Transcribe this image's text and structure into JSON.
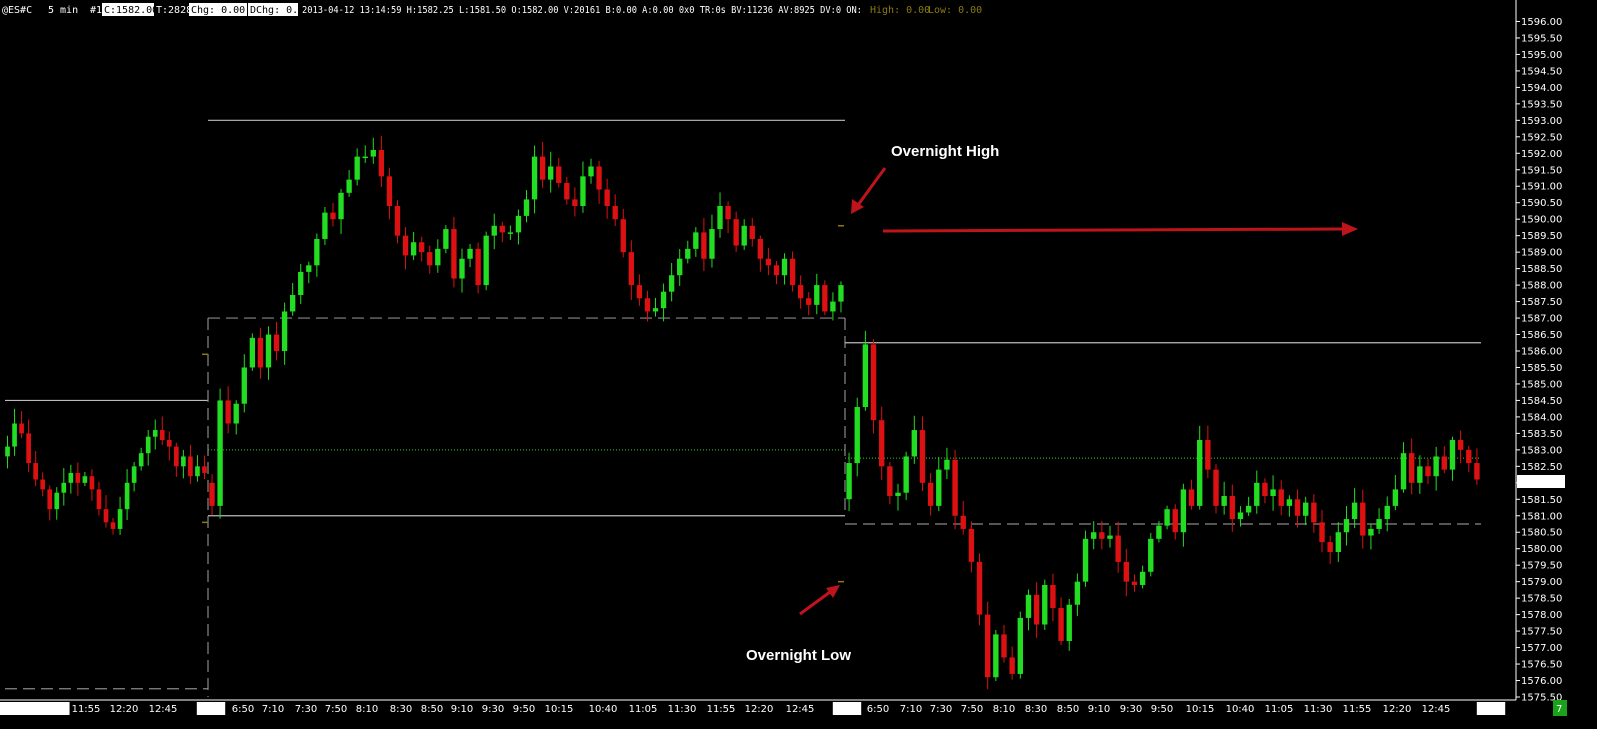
{
  "header": {
    "symbol": "@ES#C",
    "interval": "5 min",
    "id": "#1",
    "close": "C:1582.00",
    "ticks": "T:2828",
    "chg": "Chg: 0.00",
    "dchg": "DChg: 0.00",
    "info": "2013-04-12 13:14:59 H:1582.25 L:1581.50 O:1582.00 V:20161 B:0.00 A:0.00 0x0 TR:0s BV:11236 AV:8925 DV:0 ON:",
    "high": "High: 0.00",
    "low": "Low: 0.00"
  },
  "price_tag": "1582.00",
  "corner_badge": "7",
  "annotations": {
    "overnight_high": "Overnight High",
    "overnight_low": "Overnight Low"
  },
  "colors": {
    "background": "#000000",
    "up": "#22dd22",
    "down": "#dd1111",
    "level_line": "#bbbbbb",
    "dash_line": "#888888",
    "midline": "#33cc33",
    "arrow": "#c0141c"
  },
  "chart_data": {
    "type": "candlestick",
    "ylim": [
      1575.5,
      1596.5
    ],
    "yticks": [
      "1596.00",
      "1595.50",
      "1595.00",
      "1594.50",
      "1594.00",
      "1593.50",
      "1593.00",
      "1592.50",
      "1592.00",
      "1591.50",
      "1591.00",
      "1590.50",
      "1590.00",
      "1589.50",
      "1589.00",
      "1588.50",
      "1588.00",
      "1587.50",
      "1587.00",
      "1586.50",
      "1586.00",
      "1585.50",
      "1585.00",
      "1584.50",
      "1584.00",
      "1583.50",
      "1583.00",
      "1582.50",
      "1582.00",
      "1581.50",
      "1581.00",
      "1580.50",
      "1580.00",
      "1579.50",
      "1579.00",
      "1578.50",
      "1578.00",
      "1577.50",
      "1577.00",
      "1576.50",
      "1576.00",
      "1575.50"
    ],
    "xticks": [
      {
        "label": "10 11:05:00",
        "boxed": true
      },
      {
        "label": "11:55"
      },
      {
        "label": "12:20"
      },
      {
        "label": "12:45"
      },
      {
        "label": "4-11",
        "boxed": true
      },
      {
        "label": "6:50"
      },
      {
        "label": "7:10"
      },
      {
        "label": "7:30"
      },
      {
        "label": "7:50"
      },
      {
        "label": "8:10"
      },
      {
        "label": "8:30"
      },
      {
        "label": "8:50"
      },
      {
        "label": "9:10"
      },
      {
        "label": "9:30"
      },
      {
        "label": "9:50"
      },
      {
        "label": "10:15"
      },
      {
        "label": "10:40"
      },
      {
        "label": "11:05"
      },
      {
        "label": "11:30"
      },
      {
        "label": "11:55"
      },
      {
        "label": "12:20"
      },
      {
        "label": "12:45"
      },
      {
        "label": "4-12",
        "boxed": true
      },
      {
        "label": "6:50"
      },
      {
        "label": "7:10"
      },
      {
        "label": "7:30"
      },
      {
        "label": "7:50"
      },
      {
        "label": "8:10"
      },
      {
        "label": "8:30"
      },
      {
        "label": "8:50"
      },
      {
        "label": "9:10"
      },
      {
        "label": "9:30"
      },
      {
        "label": "9:50"
      },
      {
        "label": "10:15"
      },
      {
        "label": "10:40"
      },
      {
        "label": "11:05"
      },
      {
        "label": "11:30"
      },
      {
        "label": "11:55"
      },
      {
        "label": "12:20"
      },
      {
        "label": "12:45"
      },
      {
        "label": "4-13",
        "boxed": true
      }
    ],
    "session1_close": [
      1583.1,
      1583.8,
      1583.5,
      1582.6,
      1582.1,
      1581.8,
      1581.2,
      1581.7,
      1582.0,
      1582.3,
      1582.0,
      1582.2,
      1581.8,
      1581.2,
      1580.8,
      1580.6,
      1581.2,
      1582.0,
      1582.5,
      1582.9,
      1583.4,
      1583.6,
      1583.3,
      1583.1,
      1582.5,
      1582.8,
      1582.2,
      1582.5,
      1582.3
    ],
    "session2_close": [
      1581.3,
      1584.5,
      1583.8,
      1584.4,
      1585.5,
      1586.4,
      1585.5,
      1586.5,
      1586.0,
      1587.2,
      1587.7,
      1588.4,
      1588.6,
      1589.4,
      1590.2,
      1590.0,
      1590.8,
      1591.2,
      1591.9,
      1591.9,
      1592.1,
      1591.3,
      1590.4,
      1589.5,
      1588.9,
      1589.3,
      1589.0,
      1588.6,
      1589.1,
      1589.7,
      1588.2,
      1588.8,
      1589.1,
      1588.0,
      1589.5,
      1589.8,
      1589.6,
      1589.6,
      1590.1,
      1590.6,
      1591.9,
      1591.2,
      1591.6,
      1591.1,
      1590.6,
      1590.4,
      1591.3,
      1591.6,
      1590.9,
      1590.4,
      1590.0,
      1589.0,
      1588.0,
      1587.6,
      1587.2,
      1587.3,
      1587.8,
      1588.3,
      1588.8,
      1589.1,
      1589.6,
      1588.8,
      1589.7,
      1590.4,
      1590.0,
      1589.2,
      1589.8,
      1589.4,
      1588.8,
      1588.6,
      1588.3,
      1588.8,
      1588.0,
      1587.6,
      1587.4,
      1588.0,
      1587.2,
      1587.5,
      1588.0
    ],
    "session3_close": [
      1582.6,
      1584.3,
      1586.2,
      1583.9,
      1582.5,
      1581.6,
      1581.7,
      1582.8,
      1583.6,
      1582.0,
      1581.3,
      1582.4,
      1582.7,
      1581.0,
      1580.6,
      1579.6,
      1578.0,
      1576.1,
      1577.4,
      1576.7,
      1576.2,
      1577.9,
      1578.6,
      1577.7,
      1578.9,
      1578.2,
      1577.2,
      1578.3,
      1579.0,
      1580.3,
      1580.5,
      1580.3,
      1580.4,
      1579.6,
      1579.0,
      1578.9,
      1579.3,
      1580.3,
      1580.7,
      1581.2,
      1580.5,
      1581.8,
      1581.3,
      1583.3,
      1582.4,
      1581.3,
      1581.6,
      1580.9,
      1581.1,
      1581.3,
      1582.0,
      1581.6,
      1581.8,
      1581.3,
      1581.5,
      1581.0,
      1581.4,
      1580.8,
      1580.2,
      1579.9,
      1580.5,
      1580.9,
      1581.4,
      1580.4,
      1580.6,
      1580.9,
      1581.3,
      1581.8,
      1582.9,
      1582.0,
      1582.5,
      1582.2,
      1582.8,
      1582.4,
      1583.3,
      1583.0,
      1582.6,
      1582.1
    ]
  }
}
